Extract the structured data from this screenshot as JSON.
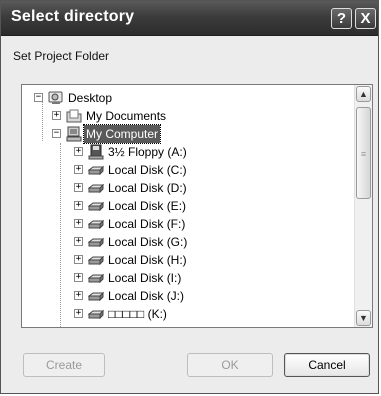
{
  "dialog": {
    "title": "Select directory",
    "help_button": "?",
    "close_button": "X",
    "subtitle": "Set Project Folder"
  },
  "tree": {
    "root": {
      "label": "Desktop",
      "expander": "−"
    },
    "my_documents": {
      "label": "My Documents",
      "expander": "+"
    },
    "my_computer": {
      "label": "My Computer",
      "expander": "−",
      "selected": true
    },
    "drives": [
      {
        "label": "3½ Floppy (A:)",
        "icon": "floppy-icon",
        "expander": "+"
      },
      {
        "label": "Local Disk (C:)",
        "icon": "disk-icon",
        "expander": "+"
      },
      {
        "label": "Local Disk (D:)",
        "icon": "disk-icon",
        "expander": "+"
      },
      {
        "label": "Local Disk (E:)",
        "icon": "disk-icon",
        "expander": "+"
      },
      {
        "label": "Local Disk (F:)",
        "icon": "disk-icon",
        "expander": "+"
      },
      {
        "label": "Local Disk (G:)",
        "icon": "disk-icon",
        "expander": "+"
      },
      {
        "label": "Local Disk (H:)",
        "icon": "disk-icon",
        "expander": "+"
      },
      {
        "label": "Local Disk (I:)",
        "icon": "disk-icon",
        "expander": "+"
      },
      {
        "label": "Local Disk (J:)",
        "icon": "disk-icon",
        "expander": "+"
      },
      {
        "label": "□□□□□ (K:)",
        "icon": "disk-icon",
        "expander": "+"
      }
    ]
  },
  "scrollbar": {
    "up_glyph": "▲",
    "down_glyph": "▼",
    "grip": "≡"
  },
  "buttons": {
    "create": "Create",
    "ok": "OK",
    "cancel": "Cancel"
  },
  "colors": {
    "titlebar": "#3c3c3c",
    "selection": "#5a5a5a",
    "disabled_text": "#9a9a9a"
  }
}
